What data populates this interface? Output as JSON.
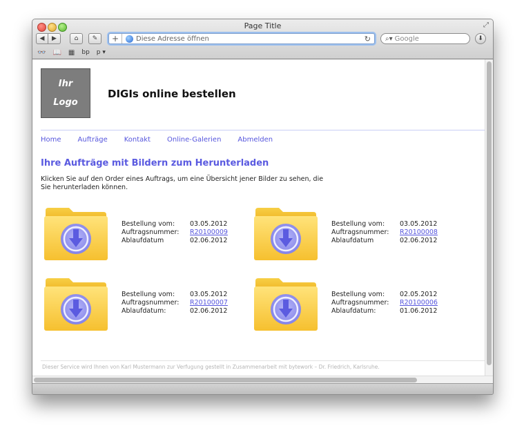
{
  "browser": {
    "title": "Page Title",
    "address_placeholder": "Diese Adresse öffnen",
    "search_placeholder": "Google",
    "bookmarks": [
      "bp",
      "p ▾"
    ]
  },
  "site": {
    "logo_line1": "Ihr",
    "logo_line2": "Logo",
    "title": "DIGIs online bestellen"
  },
  "nav": [
    "Home",
    "Aufträge",
    "Kontakt",
    "Online-Galerien",
    "Abmelden"
  ],
  "heading": "Ihre Aufträge mit Bildern zum Herunterladen",
  "intro": "Klicken Sie auf den Order eines Auftrags, um eine Übersicht jener Bilder zu sehen, die Sie herunterladen können.",
  "labels": {
    "ordered": "Bestellung vom:",
    "order_number_1": "Auftragsnummer:",
    "expiry_1": "Ablaufdatum",
    "expiry_2": "Ablaufdatum:"
  },
  "orders": [
    {
      "date": "03.05.2012",
      "number": "R20100009",
      "expiry": "02.06.2012"
    },
    {
      "date": "03.05.2012",
      "number": "R20100008",
      "expiry": "02.06.2012"
    },
    {
      "date": "03.05.2012",
      "number": "R20100007",
      "expiry": "02.06.2012"
    },
    {
      "date": "02.05.2012",
      "number": "R20100006",
      "expiry": "01.06.2012"
    }
  ],
  "footer": "Dieser Service wird Ihnen von Karl Mustermann zur Verfugung gestellt in Zusammenarbeit mit bytework – Dr. Friedrich, Karlsruhe.",
  "colors": {
    "link": "#5555dd",
    "heading": "#5a5ae0",
    "folder": "#fbd34d",
    "arrow": "#8a8aef"
  }
}
